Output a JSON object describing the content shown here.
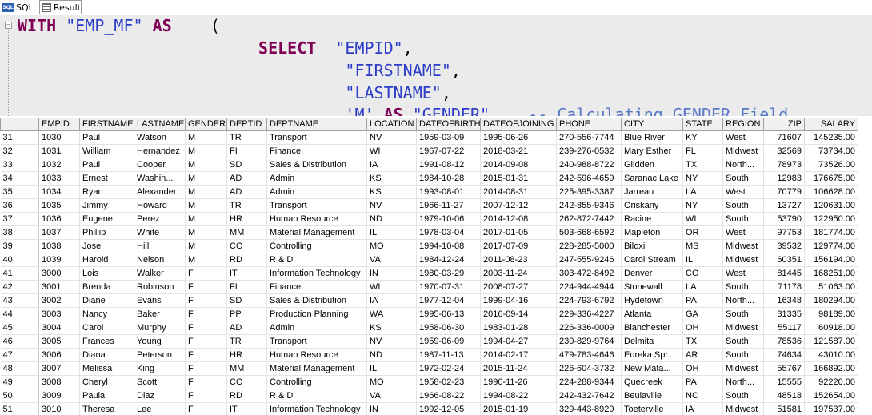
{
  "tabs": [
    {
      "label": "SQL",
      "icon": "sql-icon"
    },
    {
      "label": "Result",
      "icon": "grid-icon"
    }
  ],
  "editor": {
    "lines": [
      [
        {
          "t": "WITH",
          "c": "kw"
        },
        {
          "t": " ",
          "c": "plain"
        },
        {
          "t": "\"EMP_MF\"",
          "c": "str"
        },
        {
          "t": " ",
          "c": "plain"
        },
        {
          "t": "AS",
          "c": "kw"
        },
        {
          "t": "    (",
          "c": "plain"
        }
      ],
      [
        {
          "t": "                         ",
          "c": "plain"
        },
        {
          "t": "SELECT",
          "c": "kw"
        },
        {
          "t": "  ",
          "c": "plain"
        },
        {
          "t": "\"EMPID\"",
          "c": "str"
        },
        {
          "t": ",",
          "c": "plain"
        }
      ],
      [
        {
          "t": "                                  ",
          "c": "plain"
        },
        {
          "t": "\"FIRSTNAME\"",
          "c": "str"
        },
        {
          "t": ",",
          "c": "plain"
        }
      ],
      [
        {
          "t": "                                  ",
          "c": "plain"
        },
        {
          "t": "\"LASTNAME\"",
          "c": "str"
        },
        {
          "t": ",",
          "c": "plain"
        }
      ],
      [
        {
          "t": "                                  ",
          "c": "plain"
        },
        {
          "t": "'M'",
          "c": "str"
        },
        {
          "t": " ",
          "c": "plain"
        },
        {
          "t": "AS",
          "c": "kw"
        },
        {
          "t": " ",
          "c": "plain"
        },
        {
          "t": "\"GENDER\"",
          "c": "str"
        },
        {
          "t": "    -- Calculating GENDER Field",
          "c": "cmt"
        }
      ]
    ]
  },
  "grid": {
    "columns": [
      "",
      "EMPID",
      "FIRSTNAME",
      "LASTNAME",
      "GENDER",
      "DEPTID",
      "DEPTNAME",
      "LOCATION",
      "DATEOFBIRTH",
      "DATEOFJOINING",
      "PHONE",
      "CITY",
      "STATE",
      "REGION",
      "ZIP",
      "SALARY"
    ],
    "rows": [
      [
        "31",
        "1030",
        "Paul",
        "Watson",
        "M",
        "TR",
        "Transport",
        "NV",
        "1959-03-09",
        "1995-06-26",
        "270-556-7744",
        "Blue River",
        "KY",
        "West",
        "71607",
        "145235.00"
      ],
      [
        "32",
        "1031",
        "William",
        "Hernandez",
        "M",
        "FI",
        "Finance",
        "WI",
        "1967-07-22",
        "2018-03-21",
        "239-276-0532",
        "Mary Esther",
        "FL",
        "Midwest",
        "32569",
        "73734.00"
      ],
      [
        "33",
        "1032",
        "Paul",
        "Cooper",
        "M",
        "SD",
        "Sales & Distribution",
        "IA",
        "1991-08-12",
        "2014-09-08",
        "240-988-8722",
        "Glidden",
        "TX",
        "North...",
        "78973",
        "73526.00"
      ],
      [
        "34",
        "1033",
        "Ernest",
        "Washin...",
        "M",
        "AD",
        "Admin",
        "KS",
        "1984-10-28",
        "2015-01-31",
        "242-596-4659",
        "Saranac Lake",
        "NY",
        "South",
        "12983",
        "176675.00"
      ],
      [
        "35",
        "1034",
        "Ryan",
        "Alexander",
        "M",
        "AD",
        "Admin",
        "KS",
        "1993-08-01",
        "2014-08-31",
        "225-395-3387",
        "Jarreau",
        "LA",
        "West",
        "70779",
        "106628.00"
      ],
      [
        "36",
        "1035",
        "Jimmy",
        "Howard",
        "M",
        "TR",
        "Transport",
        "NV",
        "1966-11-27",
        "2007-12-12",
        "242-855-9346",
        "Oriskany",
        "NY",
        "South",
        "13727",
        "120631.00"
      ],
      [
        "37",
        "1036",
        "Eugene",
        "Perez",
        "M",
        "HR",
        "Human Resource",
        "ND",
        "1979-10-06",
        "2014-12-08",
        "262-872-7442",
        "Racine",
        "WI",
        "South",
        "53790",
        "122950.00"
      ],
      [
        "38",
        "1037",
        "Phillip",
        "White",
        "M",
        "MM",
        "Material Management",
        "IL",
        "1978-03-04",
        "2017-01-05",
        "503-668-6592",
        "Mapleton",
        "OR",
        "West",
        "97753",
        "181774.00"
      ],
      [
        "39",
        "1038",
        "Jose",
        "Hill",
        "M",
        "CO",
        "Controlling",
        "MO",
        "1994-10-08",
        "2017-07-09",
        "228-285-5000",
        "Biloxi",
        "MS",
        "Midwest",
        "39532",
        "129774.00"
      ],
      [
        "40",
        "1039",
        "Harold",
        "Nelson",
        "M",
        "RD",
        "R & D",
        "VA",
        "1984-12-24",
        "2011-08-23",
        "247-555-9246",
        "Carol Stream",
        "IL",
        "Midwest",
        "60351",
        "156194.00"
      ],
      [
        "41",
        "3000",
        "Lois",
        "Walker",
        "F",
        "IT",
        "Information Technology",
        "IN",
        "1980-03-29",
        "2003-11-24",
        "303-472-8492",
        "Denver",
        "CO",
        "West",
        "81445",
        "168251.00"
      ],
      [
        "42",
        "3001",
        "Brenda",
        "Robinson",
        "F",
        "FI",
        "Finance",
        "WI",
        "1970-07-31",
        "2008-07-27",
        "224-944-4944",
        "Stonewall",
        "LA",
        "South",
        "71178",
        "51063.00"
      ],
      [
        "43",
        "3002",
        "Diane",
        "Evans",
        "F",
        "SD",
        "Sales & Distribution",
        "IA",
        "1977-12-04",
        "1999-04-16",
        "224-793-6792",
        "Hydetown",
        "PA",
        "North...",
        "16348",
        "180294.00"
      ],
      [
        "44",
        "3003",
        "Nancy",
        "Baker",
        "F",
        "PP",
        "Production Planning",
        "WA",
        "1995-06-13",
        "2016-09-14",
        "229-336-4227",
        "Atlanta",
        "GA",
        "South",
        "31335",
        "98189.00"
      ],
      [
        "45",
        "3004",
        "Carol",
        "Murphy",
        "F",
        "AD",
        "Admin",
        "KS",
        "1958-06-30",
        "1983-01-28",
        "226-336-0009",
        "Blanchester",
        "OH",
        "Midwest",
        "55117",
        "60918.00"
      ],
      [
        "46",
        "3005",
        "Frances",
        "Young",
        "F",
        "TR",
        "Transport",
        "NV",
        "1959-06-09",
        "1994-04-27",
        "230-829-9764",
        "Delmita",
        "TX",
        "South",
        "78536",
        "121587.00"
      ],
      [
        "47",
        "3006",
        "Diana",
        "Peterson",
        "F",
        "HR",
        "Human Resource",
        "ND",
        "1987-11-13",
        "2014-02-17",
        "479-783-4646",
        "Eureka Spr...",
        "AR",
        "South",
        "74634",
        "43010.00"
      ],
      [
        "48",
        "3007",
        "Melissa",
        "King",
        "F",
        "MM",
        "Material Management",
        "IL",
        "1972-02-24",
        "2015-11-24",
        "226-604-3732",
        "New Mata...",
        "OH",
        "Midwest",
        "55767",
        "166892.00"
      ],
      [
        "49",
        "3008",
        "Cheryl",
        "Scott",
        "F",
        "CO",
        "Controlling",
        "MO",
        "1958-02-23",
        "1990-11-26",
        "224-288-9344",
        "Quecreek",
        "PA",
        "North...",
        "15555",
        "92220.00"
      ],
      [
        "50",
        "3009",
        "Paula",
        "Diaz",
        "F",
        "RD",
        "R & D",
        "VA",
        "1966-08-22",
        "1994-08-22",
        "242-432-7642",
        "Beulaville",
        "NC",
        "South",
        "48518",
        "152654.00"
      ],
      [
        "51",
        "3010",
        "Theresa",
        "Lee",
        "F",
        "IT",
        "Information Technology",
        "IN",
        "1992-12-05",
        "2015-01-19",
        "329-443-8929",
        "Toeterville",
        "IA",
        "Midwest",
        "51581",
        "197537.00"
      ]
    ]
  }
}
